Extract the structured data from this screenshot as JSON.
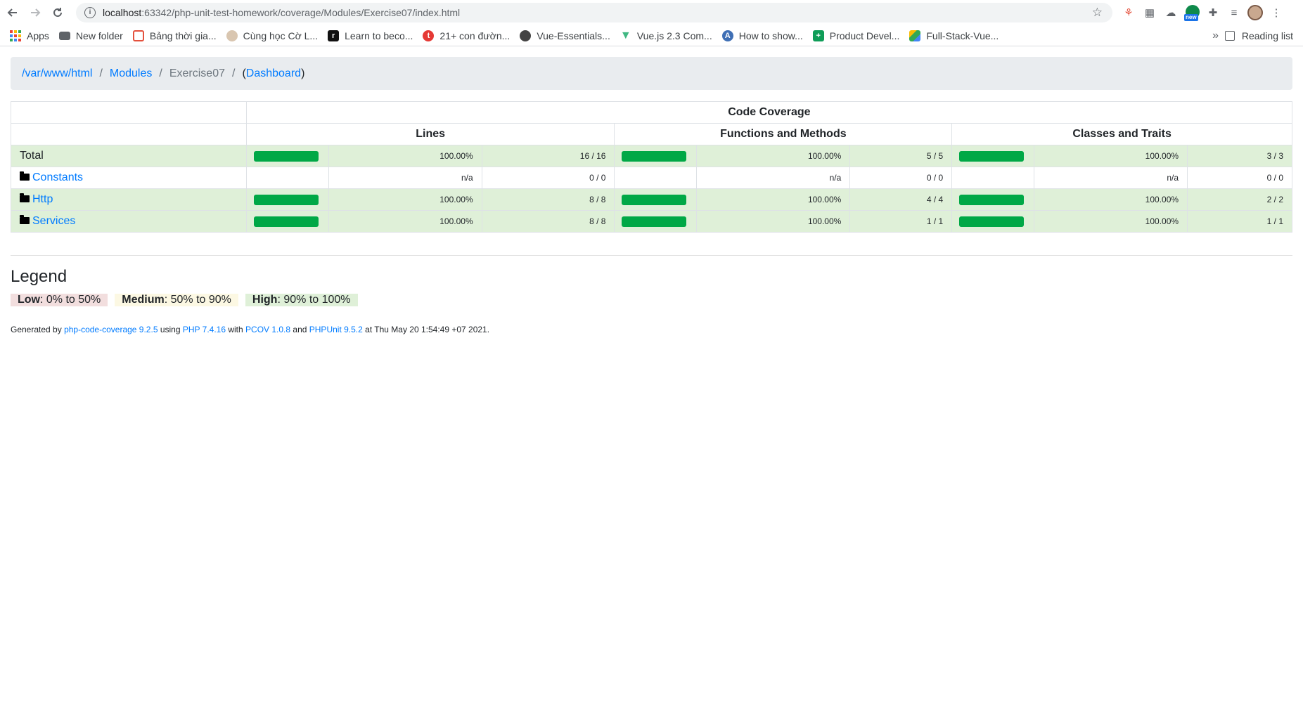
{
  "browser": {
    "url_host": "localhost",
    "url_path": ":63342/php-unit-test-homework/coverage/Modules/Exercise07/index.html",
    "bookmarks": [
      {
        "label": "Apps",
        "icon": "apps-grid-icon"
      },
      {
        "label": "New folder",
        "icon": "folder-icon"
      },
      {
        "label": "Bảng thời gia...",
        "icon": "red-hex-icon"
      },
      {
        "label": "Cùng học Cờ L...",
        "icon": "person-icon"
      },
      {
        "label": "Learn to beco...",
        "icon": "r-logo-icon"
      },
      {
        "label": "21+ con đườn...",
        "icon": "red-circle-icon"
      },
      {
        "label": "Vue-Essentials...",
        "icon": "globe-icon"
      },
      {
        "label": "Vue.js 2.3 Com...",
        "icon": "vue-icon"
      },
      {
        "label": "How to show...",
        "icon": "blue-circle-icon"
      },
      {
        "label": "Product Devel...",
        "icon": "sheets-icon"
      },
      {
        "label": "Full-Stack-Vue...",
        "icon": "drive-icon"
      }
    ],
    "more_label": "»",
    "reading_list": "Reading list",
    "ext_new_badge": "new"
  },
  "breadcrumb": {
    "root": "/var/www/html",
    "modules": "Modules",
    "current": "Exercise07",
    "sep": "/",
    "dashboard_open": "(",
    "dashboard": "Dashboard",
    "dashboard_close": ")"
  },
  "table": {
    "header_main": "Code Coverage",
    "col_lines": "Lines",
    "col_functions": "Functions and Methods",
    "col_classes": "Classes and Traits",
    "rows": [
      {
        "name": "Total",
        "link": false,
        "folder": false,
        "status": "high",
        "lines": {
          "pct": 100,
          "label": "100.00%",
          "ratio": "16 / 16"
        },
        "functions": {
          "pct": 100,
          "label": "100.00%",
          "ratio": "5 / 5"
        },
        "classes": {
          "pct": 100,
          "label": "100.00%",
          "ratio": "3 / 3"
        }
      },
      {
        "name": "Constants",
        "link": true,
        "folder": true,
        "status": "none",
        "lines": {
          "pct": null,
          "label": "n/a",
          "ratio": "0 / 0"
        },
        "functions": {
          "pct": null,
          "label": "n/a",
          "ratio": "0 / 0"
        },
        "classes": {
          "pct": null,
          "label": "n/a",
          "ratio": "0 / 0"
        }
      },
      {
        "name": "Http",
        "link": true,
        "folder": true,
        "status": "high",
        "lines": {
          "pct": 100,
          "label": "100.00%",
          "ratio": "8 / 8"
        },
        "functions": {
          "pct": 100,
          "label": "100.00%",
          "ratio": "4 / 4"
        },
        "classes": {
          "pct": 100,
          "label": "100.00%",
          "ratio": "2 / 2"
        }
      },
      {
        "name": "Services",
        "link": true,
        "folder": true,
        "status": "high",
        "lines": {
          "pct": 100,
          "label": "100.00%",
          "ratio": "8 / 8"
        },
        "functions": {
          "pct": 100,
          "label": "100.00%",
          "ratio": "1 / 1"
        },
        "classes": {
          "pct": 100,
          "label": "100.00%",
          "ratio": "1 / 1"
        }
      }
    ]
  },
  "legend": {
    "title": "Legend",
    "low_label": "Low",
    "low_range": ": 0% to 50%",
    "medium_label": "Medium",
    "medium_range": ": 50% to 90%",
    "high_label": "High",
    "high_range": ": 90% to 100%"
  },
  "footer": {
    "t1": "Generated by ",
    "tool": "php-code-coverage 9.2.5",
    "t2": " using ",
    "php": "PHP 7.4.16",
    "t3": " with ",
    "pcov": "PCOV 1.0.8",
    "t4": " and ",
    "phpunit": "PHPUnit 9.5.2",
    "t5": " at Thu May 20 1:54:49 +07 2021."
  },
  "colors": {
    "bar_fill": "#00a846",
    "high_bg": "#dff0d8",
    "low_bg": "#f2dede",
    "medium_bg": "#fcf8e3",
    "link": "#007bff"
  }
}
